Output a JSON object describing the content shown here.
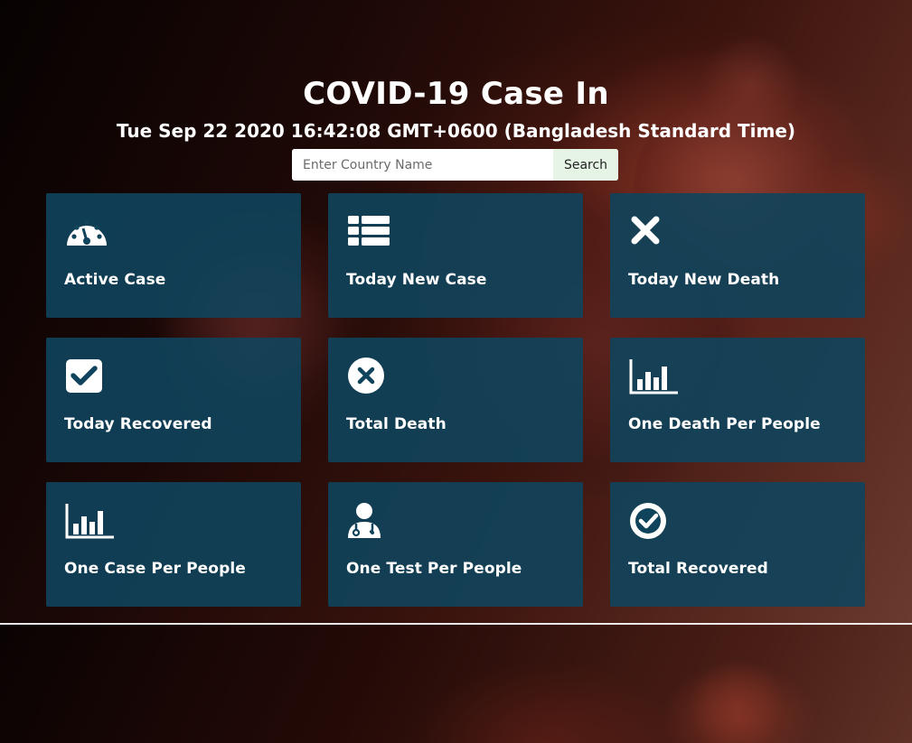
{
  "header": {
    "title": "COVID-19 Case In",
    "datetime": "Tue Sep 22 2020 16:42:08 GMT+0600 (Bangladesh Standard Time)"
  },
  "search": {
    "placeholder": "Enter Country Name",
    "button_label": "Search"
  },
  "cards": [
    {
      "label": "Active Case",
      "icon": "tachometer-icon"
    },
    {
      "label": "Today New Case",
      "icon": "list-icon"
    },
    {
      "label": "Today New Death",
      "icon": "times-icon"
    },
    {
      "label": "Today Recovered",
      "icon": "check-square-icon"
    },
    {
      "label": "Total Death",
      "icon": "times-circle-icon"
    },
    {
      "label": "One Death Per People",
      "icon": "bar-chart-icon"
    },
    {
      "label": "One Case Per People",
      "icon": "bar-chart-icon"
    },
    {
      "label": "One Test Per People",
      "icon": "user-doctor-icon"
    },
    {
      "label": "Total Recovered",
      "icon": "check-circle-icon"
    }
  ],
  "colors": {
    "card_background": "#10445c",
    "text": "#ffffff",
    "search_button_background": "#e6f4e6"
  }
}
